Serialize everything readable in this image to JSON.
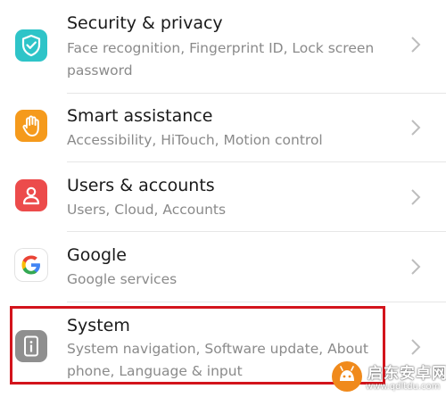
{
  "settings": {
    "items": [
      {
        "title": "Security & privacy",
        "subtitle": "Face recognition, Fingerprint ID, Lock screen password",
        "icon": "shield-check-icon",
        "icon_color": "#2ec4c8"
      },
      {
        "title": "Smart assistance",
        "subtitle": "Accessibility, HiTouch, Motion control",
        "icon": "hand-icon",
        "icon_color": "#f59a1c"
      },
      {
        "title": "Users & accounts",
        "subtitle": "Users, Cloud, Accounts",
        "icon": "user-icon",
        "icon_color": "#ec4b4b"
      },
      {
        "title": "Google",
        "subtitle": "Google services",
        "icon": "google-icon",
        "icon_color": "#ffffff"
      },
      {
        "title": "System",
        "subtitle": "System navigation, Software update, About phone, Language & input",
        "icon": "system-info-icon",
        "icon_color": "#8f8f8f"
      }
    ]
  },
  "highlight": {
    "color": "#d3141c",
    "target": "System"
  },
  "watermark": {
    "line1": "启东安卓网",
    "line2": "www.qdltdu.com"
  }
}
